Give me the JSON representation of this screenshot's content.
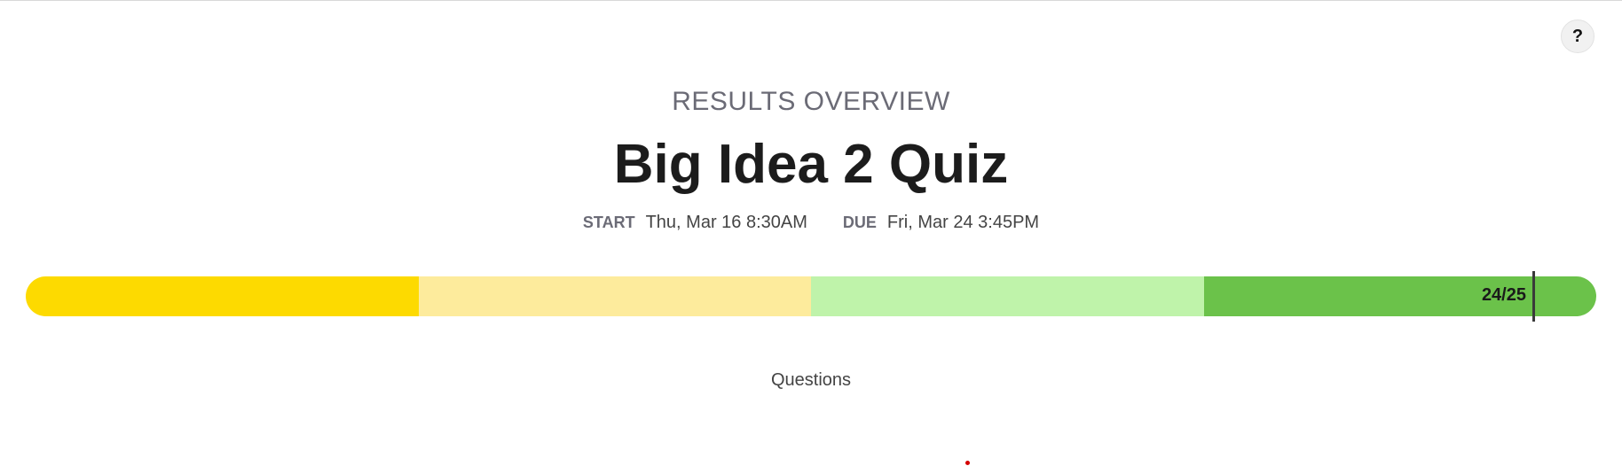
{
  "header": {
    "help_icon": "?",
    "section_label": "RESULTS OVERVIEW",
    "title": "Big Idea 2 Quiz"
  },
  "dates": {
    "start_label": "START",
    "start_value": "Thu, Mar 16 8:30AM",
    "due_label": "DUE",
    "due_value": "Fri, Mar 24 3:45PM"
  },
  "progress": {
    "score_text": "24/25",
    "score": 24,
    "total": 25,
    "segment_colors": [
      "#fdda00",
      "#fdeb9c",
      "#bff3aa",
      "#6bc24a"
    ]
  },
  "sections": {
    "questions_label": "Questions"
  },
  "colors": {
    "marker": "#d40000"
  }
}
